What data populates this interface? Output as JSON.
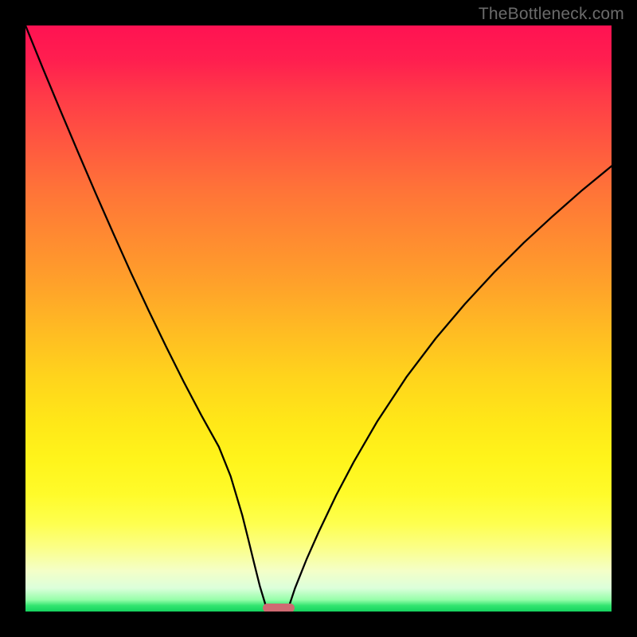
{
  "watermark": "TheBottleneck.com",
  "marker": {
    "color": "#cf6a72",
    "x_pct": 40.5,
    "width_pct": 5.4,
    "y_pct": 98.6,
    "height_pct": 1.6
  },
  "curves": {
    "left_points": [
      [
        0,
        1.0
      ],
      [
        3,
        0.926
      ],
      [
        6,
        0.854
      ],
      [
        9,
        0.783
      ],
      [
        12,
        0.713
      ],
      [
        15,
        0.645
      ],
      [
        18,
        0.578
      ],
      [
        21,
        0.514
      ],
      [
        24,
        0.452
      ],
      [
        27,
        0.392
      ],
      [
        30,
        0.335
      ],
      [
        33,
        0.281
      ],
      [
        35,
        0.231
      ],
      [
        37,
        0.164
      ],
      [
        38,
        0.124
      ],
      [
        39,
        0.083
      ],
      [
        40,
        0.043
      ],
      [
        41,
        0.01
      ]
    ],
    "right_points": [
      [
        45,
        0.01
      ],
      [
        46,
        0.04
      ],
      [
        48,
        0.09
      ],
      [
        50,
        0.135
      ],
      [
        53,
        0.198
      ],
      [
        56,
        0.255
      ],
      [
        60,
        0.324
      ],
      [
        65,
        0.4
      ],
      [
        70,
        0.466
      ],
      [
        75,
        0.525
      ],
      [
        80,
        0.579
      ],
      [
        85,
        0.629
      ],
      [
        90,
        0.675
      ],
      [
        95,
        0.719
      ],
      [
        100,
        0.76
      ]
    ]
  },
  "chart_data": {
    "type": "line",
    "title": "",
    "xlabel": "",
    "ylabel": "",
    "xlim": [
      0,
      100
    ],
    "ylim": [
      0,
      1
    ],
    "series": [
      {
        "name": "left-curve",
        "x": [
          0,
          3,
          6,
          9,
          12,
          15,
          18,
          21,
          24,
          27,
          30,
          33,
          35,
          37,
          38,
          39,
          40,
          41
        ],
        "values": [
          1.0,
          0.926,
          0.854,
          0.783,
          0.713,
          0.645,
          0.578,
          0.514,
          0.452,
          0.392,
          0.335,
          0.281,
          0.231,
          0.164,
          0.124,
          0.083,
          0.043,
          0.01
        ]
      },
      {
        "name": "right-curve",
        "x": [
          45,
          46,
          48,
          50,
          53,
          56,
          60,
          65,
          70,
          75,
          80,
          85,
          90,
          95,
          100
        ],
        "values": [
          0.01,
          0.04,
          0.09,
          0.135,
          0.198,
          0.255,
          0.324,
          0.4,
          0.466,
          0.525,
          0.579,
          0.629,
          0.675,
          0.719,
          0.76
        ]
      }
    ],
    "marker": {
      "x_range": [
        37.8,
        43.2
      ],
      "y": 0.0
    },
    "background_gradient": {
      "direction": "vertical",
      "stops": [
        [
          0.0,
          "#ff1252"
        ],
        [
          0.5,
          "#ffc21e"
        ],
        [
          0.8,
          "#fffb2a"
        ],
        [
          0.95,
          "#e8ffd2"
        ],
        [
          1.0,
          "#15d35e"
        ]
      ]
    }
  }
}
